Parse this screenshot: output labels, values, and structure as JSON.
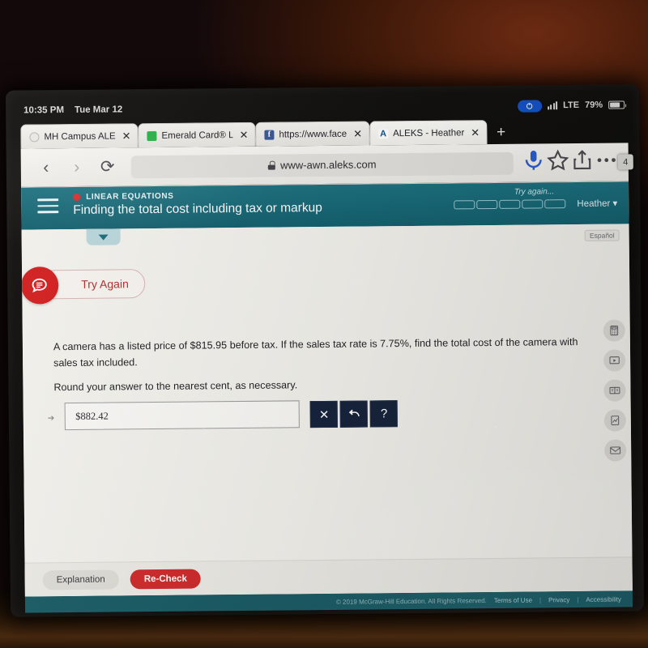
{
  "status_bar": {
    "time": "10:35 PM",
    "date": "Tue Mar 12",
    "network": "LTE",
    "battery_percent": "79%",
    "rotation_lock_icon": "rotation-lock-icon"
  },
  "browser": {
    "tab_count_badge": "4",
    "new_tab_label": "+",
    "back_label": "‹",
    "forward_label": "›",
    "reload_label": "⟳",
    "url": "www-awn.aleks.com",
    "tabs": [
      {
        "title": "MH Campus ALE",
        "favicon": "mh-campus-favicon",
        "close": "✕",
        "active": false
      },
      {
        "title": "Emerald Card® L",
        "favicon": "green-square-favicon",
        "close": "✕",
        "active": false
      },
      {
        "title": "https://www.face",
        "favicon": "facebook-favicon",
        "favicon_letter": "f",
        "close": "✕",
        "active": false
      },
      {
        "title": "ALEKS - Heather",
        "favicon": "aleks-favicon",
        "favicon_letter": "A",
        "close": "✕",
        "active": true
      }
    ],
    "toolbar_icons": [
      "microphone-icon",
      "bookmark-star-icon",
      "share-icon",
      "more-menu-icon"
    ]
  },
  "aleks": {
    "kicker": "LINEAR EQUATIONS",
    "lesson_title": "Finding the total cost including tax or markup",
    "status_text": "Try again...",
    "progress_segments": 5,
    "progress_filled": 0,
    "user_name": "Heather",
    "user_caret": "▾",
    "espanol_label": "Español",
    "try_again_label": "Try Again",
    "question": "A camera has a listed price of $815.95 before tax. If the sales tax rate is 7.75%, find the total cost of the camera with sales tax included.",
    "round_note": "Round your answer to the nearest cent, as necessary.",
    "answer_value": "$882.42",
    "answer_placeholder": "",
    "tool_buttons": [
      {
        "name": "clear-button",
        "glyph": "✕"
      },
      {
        "name": "undo-button",
        "glyph": "undo-arrow-icon"
      },
      {
        "name": "help-button",
        "glyph": "?"
      }
    ],
    "rail_icons": [
      "calculator-icon",
      "video-player-icon",
      "dictionary-icon",
      "graph-icon",
      "envelope-icon"
    ],
    "explanation_label": "Explanation",
    "recheck_label": "Re-Check"
  },
  "footer": {
    "copyright": "© 2019 McGraw-Hill Education. All Rights Reserved.",
    "links": [
      "Terms of Use",
      "Privacy",
      "Accessibility"
    ],
    "separator": "|"
  },
  "colors": {
    "teal_header": "#1a6a78",
    "accent_red": "#cf2b2b",
    "dark_button": "#17243c",
    "footer_teal": "#1b5c66"
  }
}
